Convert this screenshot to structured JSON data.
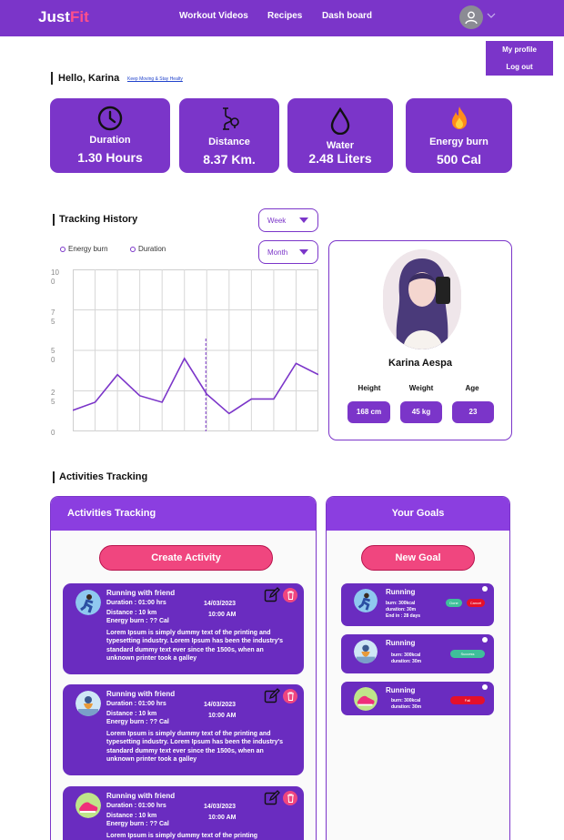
{
  "nav": {
    "logo_part1": "Just",
    "logo_part2": "Fit",
    "links": [
      "Workout Videos",
      "Recipes",
      "Dash board"
    ]
  },
  "dropdown": {
    "items": [
      "My profile",
      "Log out"
    ]
  },
  "greeting": {
    "hello": "Hello, Karina",
    "tagline": "Keep Moving & Stay Healty"
  },
  "stats": [
    {
      "label": "Duration",
      "value": "1.30 Hours",
      "icon": "clock-icon"
    },
    {
      "label": "Distance",
      "value": "8.37 Km.",
      "icon": "route-icon"
    },
    {
      "label": "Water",
      "value": "2.48 Liters",
      "icon": "water-drop-icon"
    },
    {
      "label": "Energy burn",
      "value": "500 Cal",
      "icon": "fire-icon"
    }
  ],
  "tracking": {
    "title": "Tracking History",
    "week_select": "Week",
    "month_select": "Month",
    "legend": [
      "Energy burn",
      "Duration"
    ],
    "y_ticks": [
      [
        "10",
        "0"
      ],
      [
        "7",
        "5"
      ],
      [
        "5",
        "0"
      ],
      [
        "2",
        "5"
      ],
      [
        "0",
        ""
      ]
    ]
  },
  "chart_data": {
    "type": "line",
    "series": [
      {
        "name": "Energy burn",
        "values": [
          13,
          18,
          35,
          22,
          18,
          45,
          23,
          11,
          20,
          20,
          42,
          35
        ]
      }
    ],
    "ylim": [
      0,
      100
    ],
    "grid": true
  },
  "profile": {
    "name": "Karina Aespa",
    "labels": [
      "Height",
      "Weight",
      "Age"
    ],
    "values": [
      "168 cm",
      "45 kg",
      "23"
    ]
  },
  "activities": {
    "section_title": "Activities Tracking",
    "panel_title": "Activities Tracking",
    "create_button": "Create Activity",
    "items": [
      {
        "title": "Running with friend",
        "duration": "Duration : 01:00 hrs",
        "distance": "Distance : 10 km",
        "energy": "Energy burn : ?? Cal",
        "date": "14/03/2023",
        "time": "10:00 AM",
        "desc": "Lorem Ipsum is simply dummy text of the printing and typesetting industry. Lorem Ipsum has been the industry's standard dummy text ever since the 1500s, when an unknown printer took a galley"
      },
      {
        "title": "Running with friend",
        "duration": "Duration : 01:00 hrs",
        "distance": "Distance : 10 km",
        "energy": "Energy burn : ?? Cal",
        "date": "14/03/2023",
        "time": "10:00 AM",
        "desc": "Lorem Ipsum is simply dummy text of the printing and typesetting industry. Lorem Ipsum has been the industry's standard dummy text ever since the 1500s, when an unknown printer took a galley"
      },
      {
        "title": "Running with friend",
        "duration": "Duration : 01:00 hrs",
        "distance": "Distance : 10 km",
        "energy": "Energy burn : ?? Cal",
        "date": "14/03/2023",
        "time": "10:00 AM",
        "desc": "Lorem Ipsum is simply dummy text of the printing"
      }
    ]
  },
  "goals": {
    "panel_title": "Your Goals",
    "new_button": "New Goal",
    "items": [
      {
        "title": "Running",
        "burn": "burn: 300kcal",
        "duration": "duration: 30m",
        "end": "End in : 28 days",
        "btn1": "Done",
        "btn2": "Cancel"
      },
      {
        "title": "Running",
        "burn": "burn: 300kcal",
        "duration": "duration: 30m",
        "btn1": "Success"
      },
      {
        "title": "Running",
        "burn": "burn: 300kcal",
        "duration": "duration: 30m",
        "btn1": "Fail"
      }
    ]
  }
}
